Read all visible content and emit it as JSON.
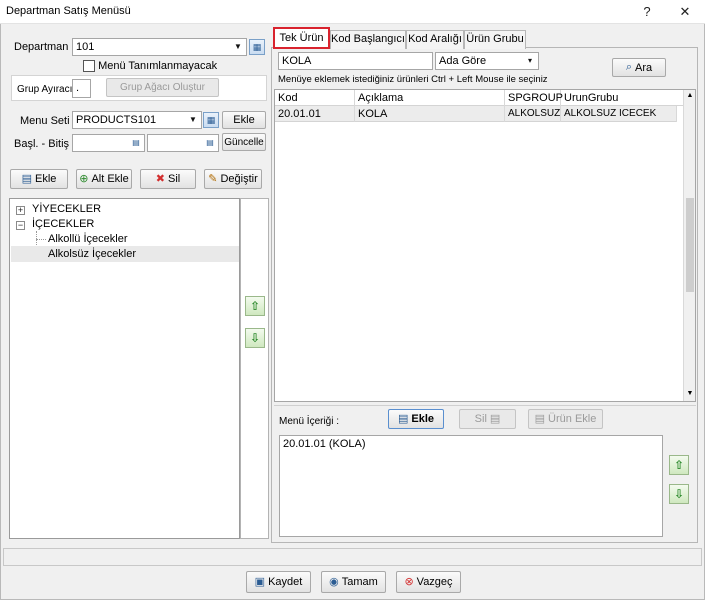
{
  "window": {
    "title": "Departman Satış Menüsü",
    "help_label": "?",
    "close_label": "✕"
  },
  "left": {
    "departman_label": "Departman",
    "departman_value": "101",
    "menu_tanim_label": "Menü Tanımlanmayacak",
    "grup_ayiraci_label": "Grup Ayıracı",
    "grup_ayiraci_value": ".",
    "grup_agaci_button": "Grup Ağacı Oluştur",
    "menu_seti_label": "Menu Seti",
    "menu_seti_value": "PRODUCTS101",
    "ekle_small_button": "Ekle",
    "basl_bitis_label": "Başl. - Bitiş",
    "guncelle_button": "Güncelle",
    "toolbar": {
      "ekle": "Ekle",
      "alt_ekle": "Alt Ekle",
      "sil": "Sil",
      "degistir": "Değiştir"
    },
    "tree": {
      "nodes": [
        {
          "label": "YİYECEKLER",
          "expander": "+"
        },
        {
          "label": "İÇECEKLER",
          "expander": "−"
        },
        {
          "label": "Alkollü İçecekler"
        },
        {
          "label": "Alkolsüz İçecekler"
        }
      ]
    }
  },
  "right": {
    "tabs": [
      "Tek Ürün",
      "Kod Başlangıcı",
      "Kod Aralığı",
      "Ürün Grubu"
    ],
    "search_value": "KOLA",
    "search_mode": "Ada Göre",
    "ara_button": "Ara",
    "hint": "Menüye eklemek istediğiniz ürünleri Ctrl + Left Mouse ile seçiniz",
    "grid": {
      "columns": [
        "Kod",
        "Açıklama",
        "SPGROUP",
        "UrunGrubu"
      ],
      "rows": [
        [
          "20.01.01",
          "KOLA",
          "ALKOLSUZ",
          "ALKOLSUZ ICECEK"
        ]
      ]
    },
    "menu_icerigi_label": "Menü İçeriği :",
    "menu_ekle_button": "Ekle",
    "menu_sil_button": "Sil",
    "urun_ekle_button": "Ürün Ekle",
    "menu_items": [
      "20.01.01 (KOLA)"
    ]
  },
  "bottom": {
    "kaydet": "Kaydet",
    "tamam": "Tamam",
    "vazgec": "Vazgeç"
  },
  "colors": {
    "active_tab_border": "#d9232e",
    "arrow_green": "#2e8b2e",
    "selection": "#e9e9e9"
  }
}
